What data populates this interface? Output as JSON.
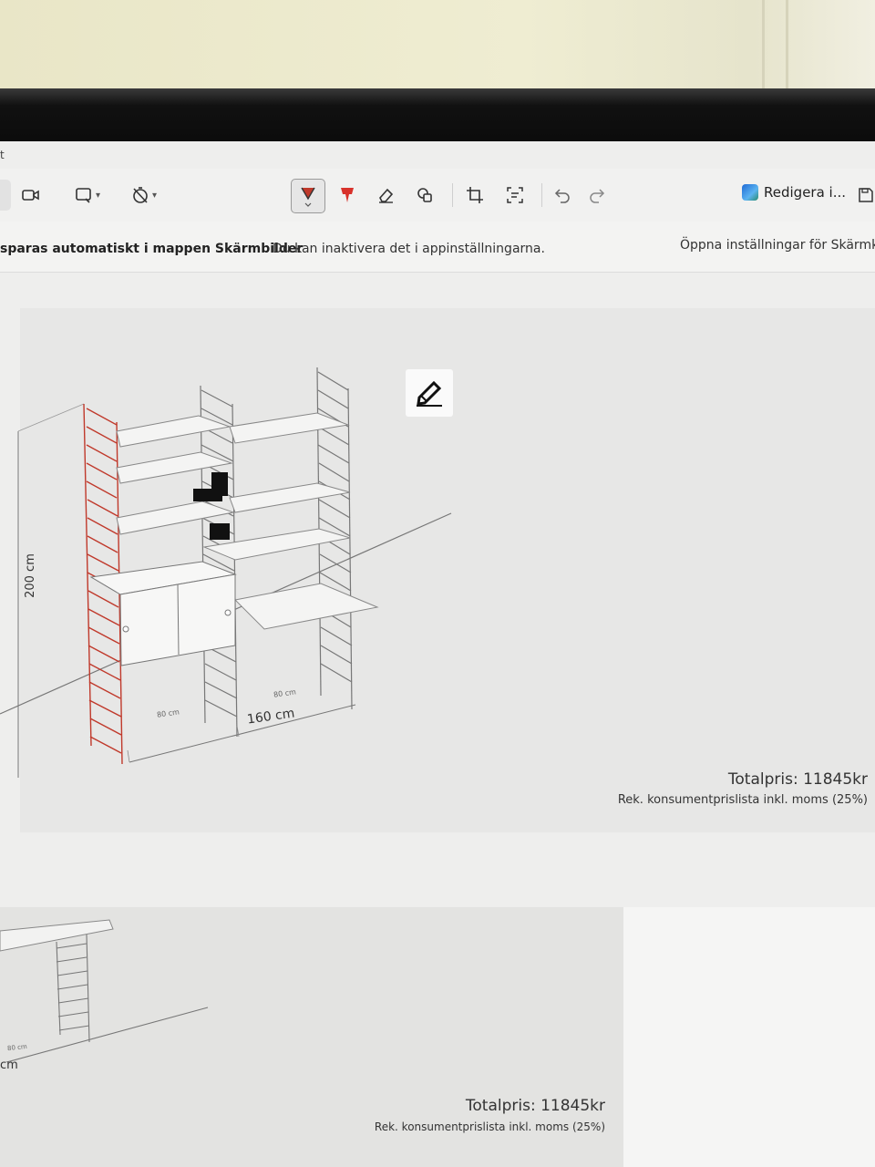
{
  "window": {
    "title_fragment": "t"
  },
  "toolbar": {
    "record_icon": "video-camera-icon",
    "snip_shape_icon": "rectangle-snip-icon",
    "delay_icon": "timer-off-icon",
    "pen_icon": "ballpoint-pen-icon",
    "highlighter_icon": "highlighter-icon",
    "eraser_icon": "eraser-icon",
    "shapes_icon": "shapes-icon",
    "crop_icon": "crop-icon",
    "text_actions_icon": "text-actions-icon",
    "undo_icon": "undo-icon",
    "redo_icon": "redo-icon",
    "edit_label": "Redigera i...",
    "save_icon": "save-icon"
  },
  "notice": {
    "strong": "sparas automatiskt i mappen Skärmbilder",
    "message": "Du kan inaktivera det i appinställningarna.",
    "link": "Öppna inställningar för Skärmklip"
  },
  "shelf": {
    "height_label": "200 cm",
    "width_label": "160 cm",
    "section_left_label": "80 cm",
    "section_right_label": "80 cm"
  },
  "price": {
    "total": "Totalpris: 11845kr",
    "note": "Rek. konsumentprislista inkl. moms (25%)"
  },
  "lower": {
    "cm_label": "cm",
    "section_label": "80 cm",
    "total": "Totalpris: 11845kr",
    "note": "Rek. konsumentprislista inkl. moms (25%)"
  },
  "colors": {
    "accent_red": "#c0392b",
    "ladder_gray": "#777777",
    "canvas_bg": "#e7e7e6"
  }
}
